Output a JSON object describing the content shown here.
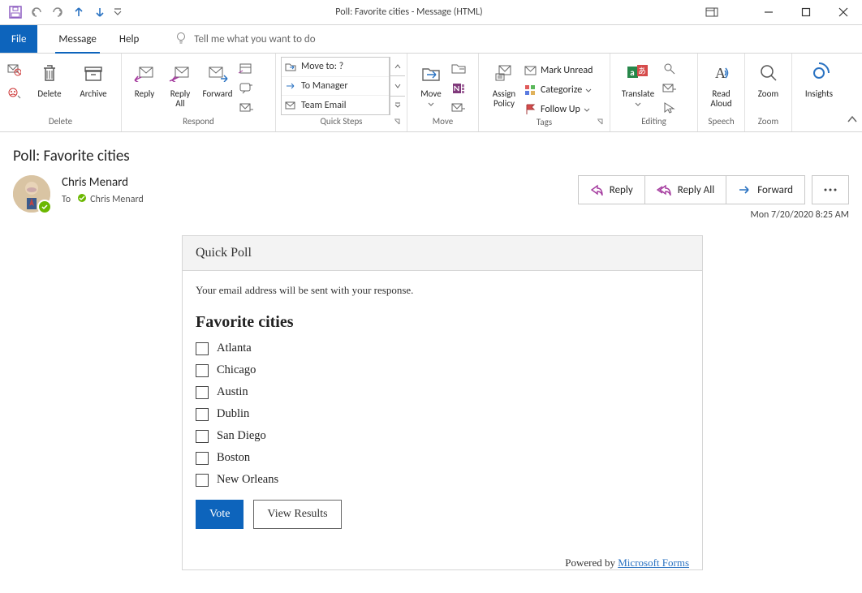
{
  "window": {
    "title": "Poll: Favorite cities  -  Message (HTML)"
  },
  "tabs": {
    "file": "File",
    "message": "Message",
    "help": "Help"
  },
  "tell_me": "Tell me what you want to do",
  "ribbon": {
    "delete": {
      "delete": "Delete",
      "archive": "Archive",
      "caption": "Delete"
    },
    "respond": {
      "reply": "Reply",
      "reply_all": "Reply\nAll",
      "forward": "Forward",
      "caption": "Respond"
    },
    "quick_steps": {
      "r1": "Move to: ?",
      "r2": "To Manager",
      "r3": "Team Email",
      "caption": "Quick Steps"
    },
    "move": {
      "move": "Move",
      "caption": "Move"
    },
    "tags": {
      "assign_policy": "Assign\nPolicy",
      "mark_unread": "Mark Unread",
      "categorize": "Categorize",
      "follow_up": "Follow Up",
      "caption": "Tags"
    },
    "editing": {
      "translate": "Translate",
      "caption": "Editing"
    },
    "speech": {
      "read_aloud": "Read\nAloud",
      "caption": "Speech"
    },
    "zoom": {
      "zoom": "Zoom",
      "caption": "Zoom"
    },
    "addins": {
      "insights": "Insights"
    }
  },
  "message": {
    "subject": "Poll: Favorite cities",
    "from": "Chris Menard",
    "to_label": "To",
    "to_value": "Chris Menard",
    "datetime": "Mon 7/20/2020 8:25 AM",
    "actions": {
      "reply": "Reply",
      "reply_all": "Reply All",
      "forward": "Forward"
    }
  },
  "poll": {
    "header": "Quick Poll",
    "note": "Your email address will be sent with your response.",
    "question": "Favorite cities",
    "options": [
      "Atlanta",
      "Chicago",
      "Austin",
      "Dublin",
      "San Diego",
      "Boston",
      "New Orleans"
    ],
    "vote": "Vote",
    "view_results": "View Results",
    "powered_prefix": "Powered by ",
    "powered_link": "Microsoft Forms"
  }
}
